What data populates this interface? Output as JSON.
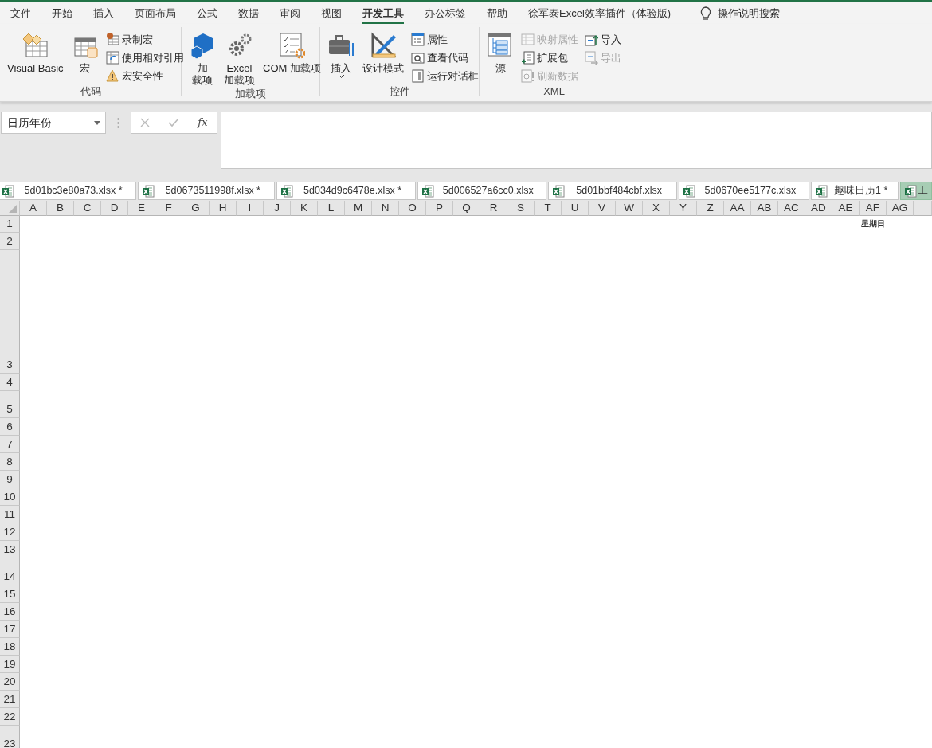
{
  "menu_tabs": [
    {
      "label": "文件",
      "selected": false
    },
    {
      "label": "开始",
      "selected": false
    },
    {
      "label": "插入",
      "selected": false
    },
    {
      "label": "页面布局",
      "selected": false
    },
    {
      "label": "公式",
      "selected": false
    },
    {
      "label": "数据",
      "selected": false
    },
    {
      "label": "审阅",
      "selected": false
    },
    {
      "label": "视图",
      "selected": false
    },
    {
      "label": "开发工具",
      "selected": true
    },
    {
      "label": "办公标签",
      "selected": false
    },
    {
      "label": "帮助",
      "selected": false
    },
    {
      "label": "徐军泰Excel效率插件（体验版)",
      "selected": false
    }
  ],
  "tell_me": {
    "label": "操作说明搜索"
  },
  "ribbon_groups": [
    {
      "label": "代码",
      "items": [
        {
          "kind": "large",
          "label": "Visual Basic",
          "disabled": false
        },
        {
          "kind": "large",
          "label": "宏",
          "disabled": false
        },
        {
          "kind": "column",
          "items": [
            {
              "label": "录制宏",
              "disabled": false
            },
            {
              "label": "使用相对引用",
              "disabled": false
            },
            {
              "label": "宏安全性",
              "disabled": false
            }
          ]
        }
      ]
    },
    {
      "label": "加载项",
      "items": [
        {
          "kind": "large",
          "lines": [
            "加",
            "载项"
          ],
          "disabled": false
        },
        {
          "kind": "large",
          "lines": [
            "Excel",
            "加载项"
          ],
          "disabled": false
        },
        {
          "kind": "large",
          "label": "COM 加载项",
          "disabled": false
        }
      ]
    },
    {
      "label": "控件",
      "items": [
        {
          "kind": "large",
          "label": "插入",
          "disabled": false,
          "dropdown": true
        },
        {
          "kind": "large",
          "label": "设计模式",
          "disabled": false
        },
        {
          "kind": "column",
          "items": [
            {
              "label": "属性",
              "disabled": false
            },
            {
              "label": "查看代码",
              "disabled": false
            },
            {
              "label": "运行对话框",
              "disabled": false
            }
          ]
        }
      ]
    },
    {
      "label": "XML",
      "items": [
        {
          "kind": "large",
          "label": "源",
          "disabled": false
        },
        {
          "kind": "column",
          "items": [
            {
              "label": "映射属性",
              "disabled": true
            },
            {
              "label": "扩展包",
              "disabled": false
            },
            {
              "label": "刷新数据",
              "disabled": true
            }
          ]
        },
        {
          "kind": "column",
          "items": [
            {
              "label": "导入",
              "disabled": false
            },
            {
              "label": "导出",
              "disabled": true
            }
          ]
        }
      ]
    }
  ],
  "formula_bar": {
    "name_box": "日历年份",
    "function_label": "fx"
  },
  "workbook_tabs": [
    {
      "label": "5d01bc3e80a73.xlsx *",
      "selected": false
    },
    {
      "label": "5d0673511998f.xlsx *",
      "selected": false
    },
    {
      "label": "5d034d9c6478e.xlsx *",
      "selected": false
    },
    {
      "label": "5d006527a6cc0.xlsx",
      "selected": false
    },
    {
      "label": "5d01bbf484cbf.xlsx",
      "selected": false
    },
    {
      "label": "5d0670ee5177c.xlsx",
      "selected": false
    },
    {
      "label": "趣味日历1 *",
      "selected": false
    },
    {
      "label": "工",
      "selected": true
    }
  ],
  "sheet": {
    "columns": [
      "A",
      "B",
      "C",
      "D",
      "E",
      "F",
      "G",
      "H",
      "I",
      "J",
      "K",
      "L",
      "M",
      "N",
      "O",
      "P",
      "Q",
      "R",
      "S",
      "T",
      "U",
      "V",
      "W",
      "X",
      "Y",
      "Z",
      "AA",
      "AB",
      "AC",
      "AD",
      "AE",
      "AF",
      "AG"
    ],
    "rows": [
      {
        "label": "1",
        "cells": {
          "AF": "星期日"
        }
      },
      {
        "label": "2"
      },
      {
        "label": "3"
      },
      {
        "label": "4"
      },
      {
        "label": "5"
      },
      {
        "label": "6"
      },
      {
        "label": "7"
      },
      {
        "label": "8"
      },
      {
        "label": "9"
      },
      {
        "label": "10"
      },
      {
        "label": "11"
      },
      {
        "label": "12"
      },
      {
        "label": "13"
      },
      {
        "label": "14"
      },
      {
        "label": "15"
      },
      {
        "label": "16"
      },
      {
        "label": "17"
      },
      {
        "label": "18"
      },
      {
        "label": "19"
      },
      {
        "label": "20"
      },
      {
        "label": "21"
      },
      {
        "label": "22"
      },
      {
        "label": "23"
      }
    ]
  }
}
